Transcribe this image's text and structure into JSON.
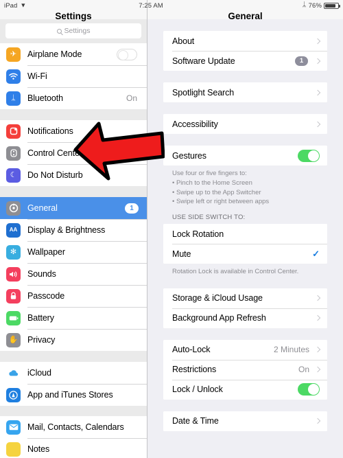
{
  "status_bar": {
    "device": "iPad",
    "wifi_icon": "wifi-icon",
    "time": "7:25 AM",
    "bluetooth_icon": "bluetooth-icon",
    "battery_percent": "76%"
  },
  "sidebar": {
    "title": "Settings",
    "search": {
      "placeholder": "Settings",
      "value": "",
      "icon": "search-icon"
    },
    "groups": [
      {
        "items": [
          {
            "label": "Airplane Mode",
            "icon": "airplane-icon",
            "icon_color": "#f5a623",
            "glyph": "✈",
            "accessory": "toggle-off"
          },
          {
            "label": "Wi-Fi",
            "icon": "wifi-icon",
            "icon_color": "#2f7fe8",
            "glyph": "ᵚ",
            "accessory": "none"
          },
          {
            "label": "Bluetooth",
            "icon": "bluetooth-icon",
            "icon_color": "#2f7fe8",
            "glyph": "ᛦ",
            "accessory": "value",
            "value": "On"
          }
        ]
      },
      {
        "items": [
          {
            "label": "Notifications",
            "icon": "notifications-icon",
            "icon_color": "#f43f3b",
            "glyph": "▢",
            "accessory": "none"
          },
          {
            "label": "Control Center",
            "icon": "control-center-icon",
            "icon_color": "#8e8e93",
            "glyph": "◎",
            "accessory": "none"
          },
          {
            "label": "Do Not Disturb",
            "icon": "do-not-disturb-icon",
            "icon_color": "#5b5ce2",
            "glyph": "☾",
            "accessory": "none"
          }
        ]
      },
      {
        "items": [
          {
            "label": "General",
            "icon": "general-icon",
            "icon_color": "#8e8e93",
            "glyph": "⚙",
            "accessory": "badge",
            "badge": "1",
            "selected": true
          },
          {
            "label": "Display & Brightness",
            "icon": "display-brightness-icon",
            "icon_color": "#1f6fd0",
            "glyph": "AA",
            "accessory": "none"
          },
          {
            "label": "Wallpaper",
            "icon": "wallpaper-icon",
            "icon_color": "#38aee0",
            "glyph": "✻",
            "accessory": "none"
          },
          {
            "label": "Sounds",
            "icon": "sounds-icon",
            "icon_color": "#f43f5e",
            "glyph": "🔊",
            "accessory": "none"
          },
          {
            "label": "Passcode",
            "icon": "passcode-icon",
            "icon_color": "#f43f5e",
            "glyph": "🔒",
            "accessory": "none"
          },
          {
            "label": "Battery",
            "icon": "battery-icon",
            "icon_color": "#4cd964",
            "glyph": "▬",
            "accessory": "none"
          },
          {
            "label": "Privacy",
            "icon": "privacy-icon",
            "icon_color": "#8e8e93",
            "glyph": "✋",
            "accessory": "none"
          }
        ]
      },
      {
        "items": [
          {
            "label": "iCloud",
            "icon": "icloud-icon",
            "icon_color": "#ffffff",
            "glyph": "☁",
            "accessory": "none"
          },
          {
            "label": "App and iTunes Stores",
            "icon": "app-store-icon",
            "icon_color": "#1f7fe0",
            "glyph": "Ⓐ",
            "accessory": "none"
          }
        ]
      },
      {
        "items": [
          {
            "label": "Mail, Contacts, Calendars",
            "icon": "mail-icon",
            "icon_color": "#36a5ef",
            "glyph": "✉",
            "accessory": "none"
          },
          {
            "label": "Notes",
            "icon": "notes-icon",
            "icon_color": "#f5d33f",
            "glyph": "✎",
            "accessory": "none"
          }
        ]
      }
    ]
  },
  "detail": {
    "title": "General",
    "group_1": [
      {
        "label": "About",
        "accessory": "chevron"
      },
      {
        "label": "Software Update",
        "accessory": "badge-chevron",
        "badge": "1"
      }
    ],
    "group_2": [
      {
        "label": "Spotlight Search",
        "accessory": "chevron"
      }
    ],
    "group_3": [
      {
        "label": "Accessibility",
        "accessory": "chevron"
      }
    ],
    "gestures": {
      "label": "Gestures",
      "toggle": "on",
      "footnote_lines": [
        "Use four or five fingers to:",
        "• Pinch to the Home Screen",
        "• Swipe up to the App Switcher",
        "• Swipe left or right between apps"
      ]
    },
    "side_switch": {
      "header": "USE SIDE SWITCH TO:",
      "options": [
        {
          "label": "Lock Rotation",
          "checked": false
        },
        {
          "label": "Mute",
          "checked": true
        }
      ],
      "footnote": "Rotation Lock is available in Control Center."
    },
    "group_4": [
      {
        "label": "Storage & iCloud Usage",
        "accessory": "chevron"
      },
      {
        "label": "Background App Refresh",
        "accessory": "chevron"
      }
    ],
    "group_5": [
      {
        "label": "Auto-Lock",
        "accessory": "value-chevron",
        "value": "2 Minutes"
      },
      {
        "label": "Restrictions",
        "accessory": "value-chevron",
        "value": "On"
      },
      {
        "label": "Lock / Unlock",
        "accessory": "toggle-on"
      }
    ],
    "group_6": [
      {
        "label": "Date & Time",
        "accessory": "chevron"
      }
    ]
  },
  "annotation": {
    "arrow": {
      "color": "#ee1c1c",
      "outline": "#000000",
      "points_to": "Notifications"
    }
  }
}
